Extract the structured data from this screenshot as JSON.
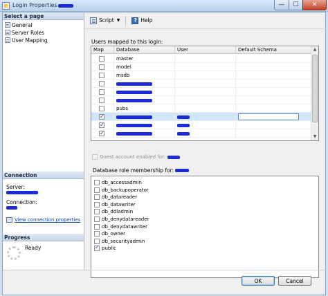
{
  "window": {
    "title": "Login Properties -",
    "minimize": "—",
    "maximize": "☐",
    "close": "✕"
  },
  "sidebar": {
    "select_page_header": "Select a page",
    "pages": [
      {
        "label": "General"
      },
      {
        "label": "Server Roles"
      },
      {
        "label": "User Mapping"
      }
    ],
    "connection_header": "Connection",
    "server_label": "Server:",
    "connection_label": "Connection:",
    "view_connection_link": "View connection properties",
    "progress_header": "Progress",
    "progress_status": "Ready"
  },
  "toolbar": {
    "script_label": "Script",
    "help_label": "Help"
  },
  "users_mapped": {
    "label": "Users mapped to this login:",
    "columns": [
      "Map",
      "Database",
      "User",
      "Default Schema"
    ],
    "rows": [
      {
        "checked": false,
        "database": "master",
        "user": "",
        "redacted_db": false,
        "redacted_user": false,
        "selected": false
      },
      {
        "checked": false,
        "database": "model",
        "user": "",
        "redacted_db": false,
        "redacted_user": false,
        "selected": false
      },
      {
        "checked": false,
        "database": "msdb",
        "user": "",
        "redacted_db": false,
        "redacted_user": false,
        "selected": false
      },
      {
        "checked": false,
        "database": "",
        "user": "",
        "redacted_db": true,
        "redacted_user": false,
        "selected": false
      },
      {
        "checked": false,
        "database": "",
        "user": "",
        "redacted_db": true,
        "redacted_user": false,
        "selected": false
      },
      {
        "checked": false,
        "database": "",
        "user": "",
        "redacted_db": true,
        "redacted_user": false,
        "selected": false
      },
      {
        "checked": false,
        "database": "pubs",
        "user": "",
        "redacted_db": false,
        "redacted_user": false,
        "selected": false
      },
      {
        "checked": true,
        "database": "",
        "user": "",
        "redacted_db": true,
        "redacted_user": true,
        "selected": true
      },
      {
        "checked": true,
        "database": "",
        "user": "",
        "redacted_db": true,
        "redacted_user": true,
        "selected": false
      },
      {
        "checked": true,
        "database": "",
        "user": "",
        "redacted_db": true,
        "redacted_user": true,
        "selected": false
      }
    ]
  },
  "guest": {
    "label": "Guest account enabled for:",
    "checked": false
  },
  "roles": {
    "label": "Database role membership for:",
    "items": [
      {
        "label": "db_accessadmin",
        "checked": false
      },
      {
        "label": "db_backupoperator",
        "checked": false
      },
      {
        "label": "db_datareader",
        "checked": false
      },
      {
        "label": "db_datawriter",
        "checked": false
      },
      {
        "label": "db_ddladmin",
        "checked": false
      },
      {
        "label": "db_denydatareader",
        "checked": false
      },
      {
        "label": "db_denydatawriter",
        "checked": false
      },
      {
        "label": "db_owner",
        "checked": false
      },
      {
        "label": "db_securityadmin",
        "checked": false
      },
      {
        "label": "public",
        "checked": true
      }
    ]
  },
  "buttons": {
    "ok": "OK",
    "cancel": "Cancel"
  }
}
